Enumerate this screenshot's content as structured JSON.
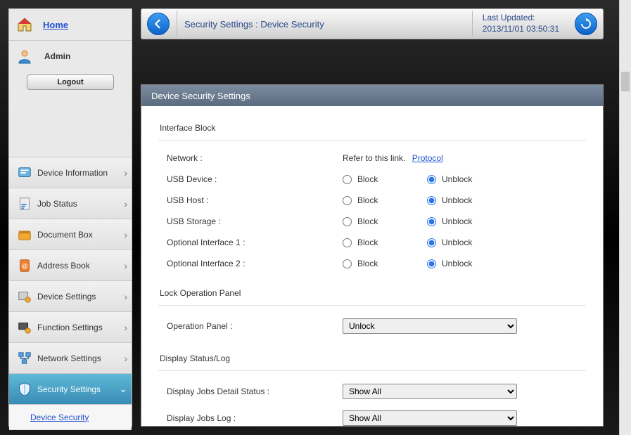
{
  "sidebar": {
    "home_label": "Home",
    "user_label": "Admin",
    "logout_label": "Logout",
    "nav": [
      {
        "label": "Device Information"
      },
      {
        "label": "Job Status"
      },
      {
        "label": "Document Box"
      },
      {
        "label": "Address Book"
      },
      {
        "label": "Device Settings"
      },
      {
        "label": "Function Settings"
      },
      {
        "label": "Network Settings"
      },
      {
        "label": "Security Settings"
      }
    ],
    "sub_item": "Device Security"
  },
  "topbar": {
    "breadcrumb": "Security Settings : Device Security",
    "last_updated_label": "Last Updated:",
    "last_updated_value": "2013/11/01 03:50:31"
  },
  "panel": {
    "title": "Device Security Settings",
    "section_interface_block": "Interface Block",
    "network_label": "Network :",
    "network_note": "Refer to this link.",
    "network_link": "Protocol",
    "rows": [
      {
        "label": "USB Device :"
      },
      {
        "label": "USB Host :"
      },
      {
        "label": "USB Storage :"
      },
      {
        "label": "Optional Interface 1 :"
      },
      {
        "label": "Optional Interface 2 :"
      }
    ],
    "opt_block": "Block",
    "opt_unblock": "Unblock",
    "section_lock": "Lock Operation Panel",
    "operation_panel_label": "Operation Panel :",
    "operation_panel_value": "Unlock",
    "section_display": "Display Status/Log",
    "display_rows": [
      {
        "label": "Display Jobs Detail Status :",
        "value": "Show All"
      },
      {
        "label": "Display Jobs Log :",
        "value": "Show All"
      }
    ]
  }
}
